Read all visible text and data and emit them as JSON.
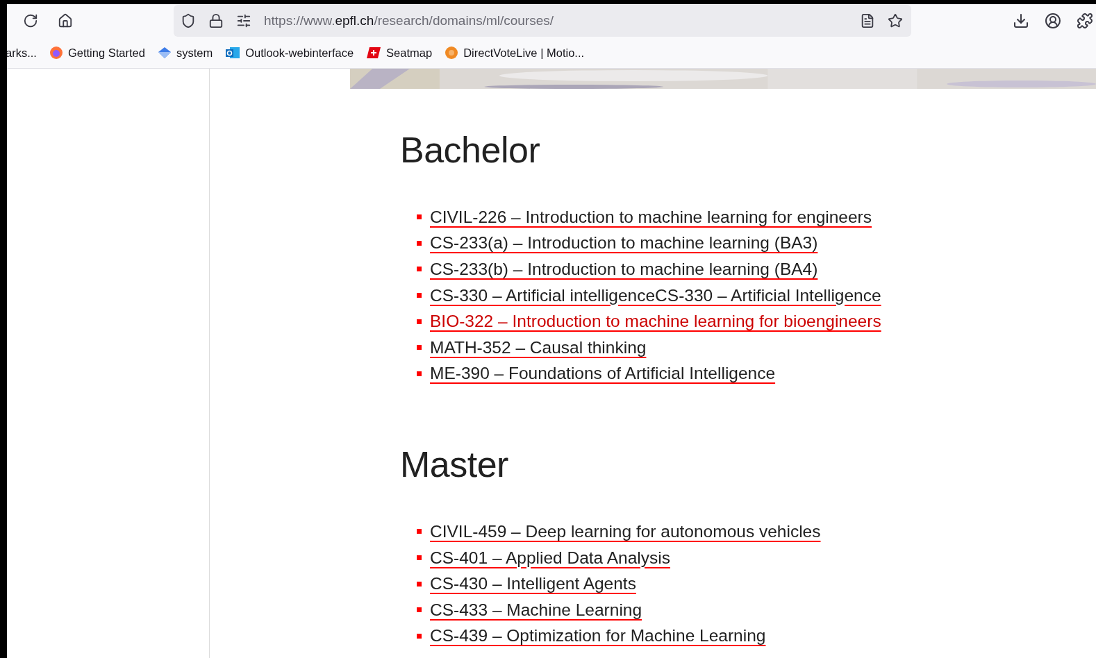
{
  "toolbar": {
    "url_prefix": "https://www.",
    "url_domain": "epfl.ch",
    "url_path": "/research/domains/ml/courses/"
  },
  "bookmarks": [
    {
      "label": "arks..."
    },
    {
      "label": "Getting Started"
    },
    {
      "label": "system"
    },
    {
      "label": "Outlook-webinterface"
    },
    {
      "label": "Seatmap"
    },
    {
      "label": "DirectVoteLive | Motio..."
    }
  ],
  "sections": [
    {
      "heading": "Bachelor",
      "courses": [
        {
          "label": "CIVIL-226 – Introduction to machine learning for engineers",
          "hovered": false
        },
        {
          "label": "CS-233(a) – Introduction to machine learning (BA3)",
          "hovered": false
        },
        {
          "label": "CS-233(b) – Introduction to machine learning (BA4)",
          "hovered": false
        },
        {
          "label": "CS-330 – Artificial intelligenceCS-330 – Artificial Intelligence",
          "hovered": false
        },
        {
          "label": "BIO-322 – Introduction to machine learning for bioengineers",
          "hovered": true
        },
        {
          "label": "MATH-352 – Causal thinking",
          "hovered": false
        },
        {
          "label": "ME-390 – Foundations of Artificial Intelligence",
          "hovered": false
        }
      ]
    },
    {
      "heading": "Master",
      "courses": [
        {
          "label": "CIVIL-459 – Deep learning for autonomous vehicles",
          "hovered": false
        },
        {
          "label": "CS-401 – Applied Data Analysis",
          "hovered": false
        },
        {
          "label": "CS-430 – Intelligent Agents",
          "hovered": false
        },
        {
          "label": "CS-433 – Machine Learning",
          "hovered": false
        },
        {
          "label": "CS-439 – Optimization for Machine Learning",
          "hovered": false
        }
      ]
    }
  ]
}
